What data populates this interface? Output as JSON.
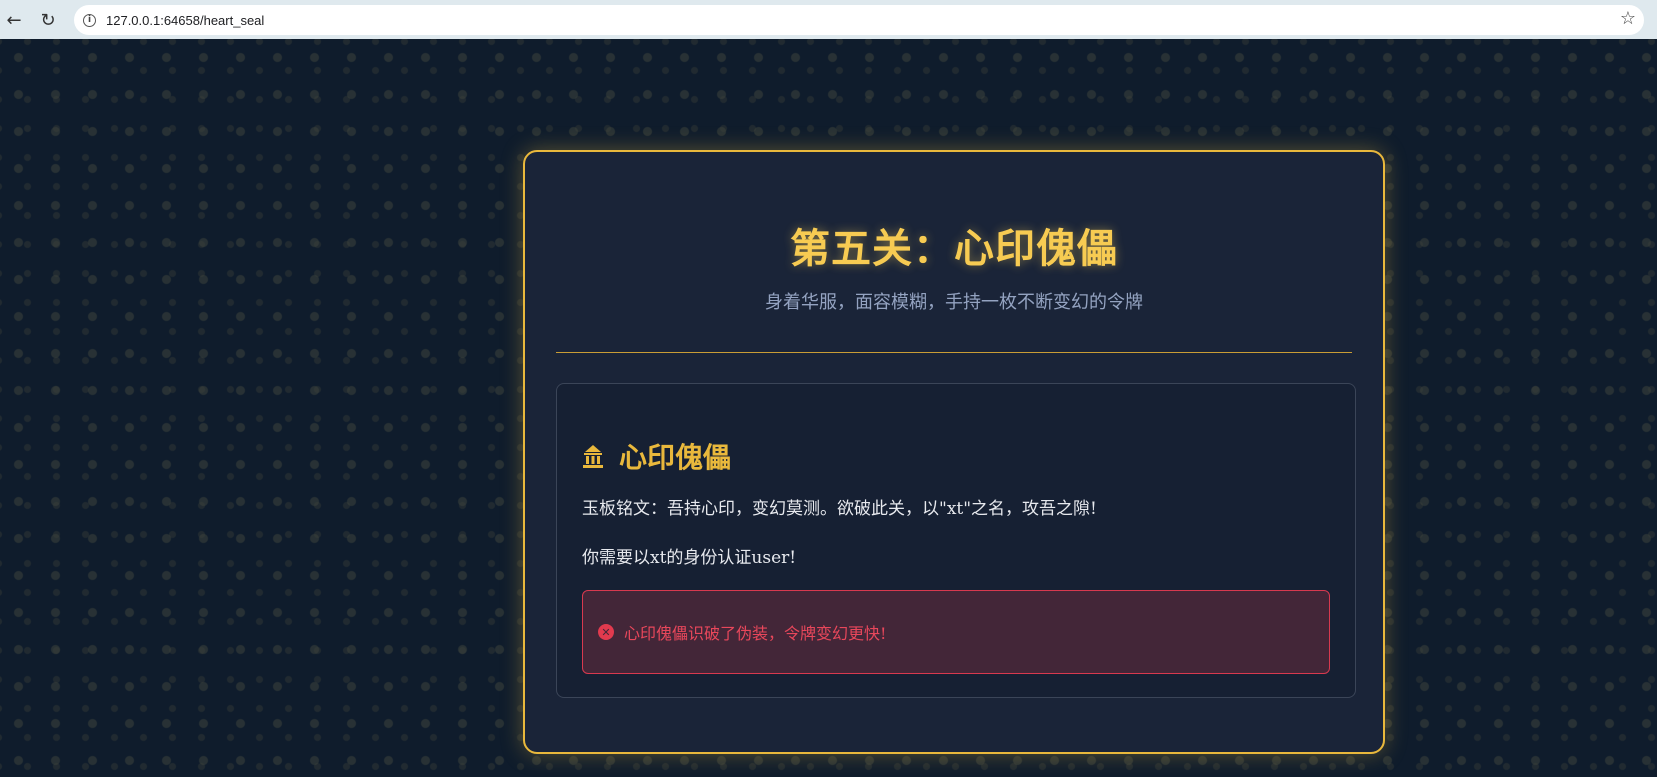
{
  "browser": {
    "url": "127.0.0.1:64658/heart_seal",
    "back_icon": "arrow-left-icon",
    "reload_icon": "reload-icon",
    "info_icon": "info-icon",
    "bookmark_icon": "star-icon"
  },
  "card": {
    "title": "第五关：心印傀儡",
    "subtitle": "身着华服，面容模糊，手持一枚不断变幻的令牌",
    "accent_color": "#e9b83c"
  },
  "challenge": {
    "icon": "temple-icon",
    "heading": "心印傀儡",
    "inscription": "玉板铭文：吾持心印，变幻莫测。欲破此关，以\"xt\"之名，攻吾之隙!",
    "task": "你需要以xt的身份认证user!",
    "error": {
      "icon": "error-circle-icon",
      "message": "心印傀儡识破了伪装，令牌变幻更快!",
      "color": "#e8475b"
    }
  }
}
